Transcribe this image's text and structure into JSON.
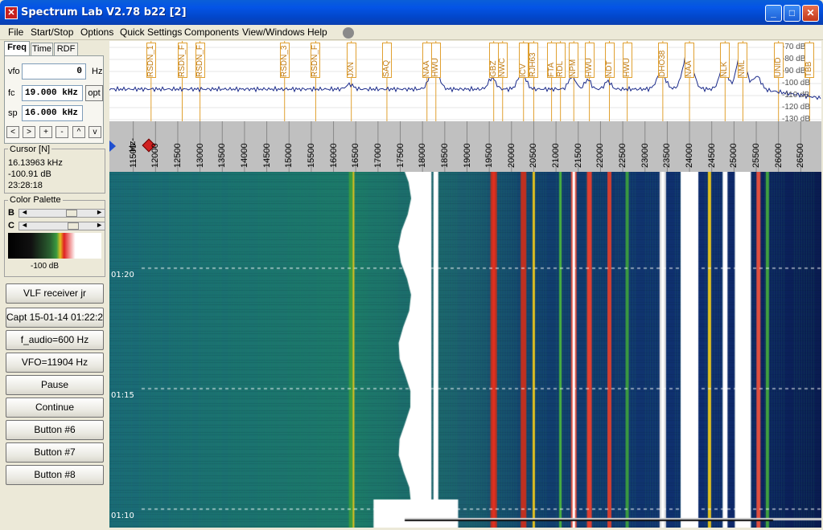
{
  "window": {
    "title": "Spectrum Lab V2.78 b22 [2]",
    "app_icon": "spectrum-lab-icon"
  },
  "menu": {
    "items": [
      "File",
      "Start/Stop",
      "Options",
      "Quick Settings",
      "Components",
      "View/Windows",
      "Help"
    ]
  },
  "tabs": [
    "Freq",
    "Time",
    "RDF"
  ],
  "freq": {
    "vfo_label": "vfo",
    "vfo_value": "0",
    "vfo_unit": "Hz",
    "fc_label": "fc",
    "fc_value": "19.000",
    "fc_unit": "kHz",
    "sp_label": "sp",
    "sp_value": "16.000",
    "sp_unit": "kHz",
    "opt": "opt",
    "step_buttons": [
      "<",
      ">",
      "+",
      "-",
      "^",
      "v"
    ]
  },
  "cursor": {
    "title": "Cursor [N]",
    "freq": "16.13963 kHz",
    "level": "-100.91 dB",
    "time": "23:28:18"
  },
  "palette": {
    "title": "Color Palette",
    "b_label": "B",
    "c_label": "C",
    "db": "-100 dB"
  },
  "buttons": [
    "VLF receiver jr",
    "Capt 15-01-14 01:22:2",
    "f_audio=600 Hz",
    "VFO=11904 Hz",
    "Pause",
    "Continue",
    "Button #6",
    "Button #7",
    "Button #8"
  ],
  "axis": {
    "hz_label": "Hz-",
    "ticks": [
      "11500",
      "12000",
      "12500",
      "13000",
      "13500",
      "14000",
      "14500",
      "15000",
      "15500",
      "16000",
      "16500",
      "17000",
      "17500",
      "18000",
      "18500",
      "19000",
      "19500",
      "20000",
      "20500",
      "21000",
      "21500",
      "22000",
      "22500",
      "23000",
      "23500",
      "24000",
      "24500",
      "25000",
      "25500",
      "26000",
      "26500"
    ],
    "min_khz": 11.0,
    "max_khz": 27.0
  },
  "db_scale": [
    "-70 dB",
    "-80 dB",
    "-90 dB",
    "-100 dB",
    "-110 dB",
    "-120 dB",
    "-130 dB"
  ],
  "stations": [
    {
      "label": "RSDN_1",
      "khz": 11.9
    },
    {
      "label": "RSDN_F",
      "khz": 12.6
    },
    {
      "label": "RSDN_F",
      "khz": 13.0
    },
    {
      "label": "RSDN_3",
      "khz": 14.9
    },
    {
      "label": "RSDN_F",
      "khz": 15.6
    },
    {
      "label": "JXN",
      "khz": 16.4
    },
    {
      "label": "SAQ",
      "khz": 17.2
    },
    {
      "label": "NAA",
      "khz": 18.1
    },
    {
      "label": "HWU",
      "khz": 18.3
    },
    {
      "label": "GBZ",
      "khz": 19.6
    },
    {
      "label": "NWC",
      "khz": 19.8
    },
    {
      "label": "ICV",
      "khz": 20.27
    },
    {
      "label": "RJH63",
      "khz": 20.5
    },
    {
      "label": "FTA",
      "khz": 20.9
    },
    {
      "label": "RDL",
      "khz": 21.1
    },
    {
      "label": "NPM",
      "khz": 21.4
    },
    {
      "label": "HWU",
      "khz": 21.75
    },
    {
      "label": "NDT",
      "khz": 22.2
    },
    {
      "label": "HWU",
      "khz": 22.6
    },
    {
      "label": "DHO38",
      "khz": 23.4
    },
    {
      "label": "NAA",
      "khz": 24.0
    },
    {
      "label": "NLK",
      "khz": 24.8
    },
    {
      "label": "NML",
      "khz": 25.2
    },
    {
      "label": "UNID",
      "khz": 26.0
    },
    {
      "label": "TBB",
      "khz": 26.7
    }
  ],
  "times": [
    "01:20",
    "01:15",
    "01:10"
  ],
  "colors": {
    "title_blue": "#0454e6",
    "trace": "#1a2a8a",
    "marker": "#e0a030"
  }
}
